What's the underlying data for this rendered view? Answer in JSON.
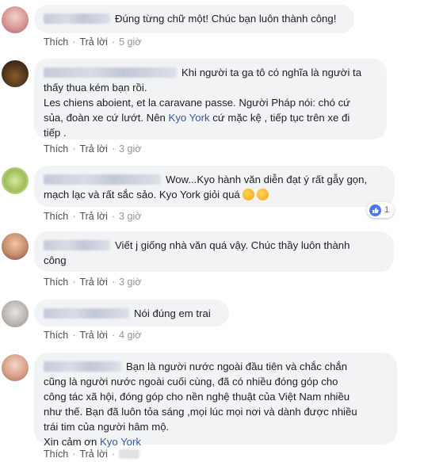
{
  "actions": {
    "like_label": "Thích",
    "reply_label": "Trả lời",
    "separator": "·"
  },
  "comments": [
    {
      "text": "Đúng từng chữ một! Chúc bạn luôn thành công!",
      "time": "5 giờ"
    },
    {
      "lines": [
        "Khi người ta ga tô có nghĩa là người ta",
        "thấy thua kém bạn rồi.",
        "Les chiens aboient, et la caravane passe. Người Pháp nói: chó cứ",
        "sủa, đoàn xe cứ lướt. Nên ",
        " cứ mặc kệ , tiếp tục trên xe đi",
        "tiếp ."
      ],
      "mention": "Kyo York",
      "time": "3 giờ"
    },
    {
      "lines": [
        "Wow...Kyo hành văn diễn đạt ý rất gẫy gọn,",
        "mạch lạc và rất sắc sảo. Kyo York giỏi quá"
      ],
      "time": "3 giờ",
      "reaction_count": "1"
    },
    {
      "lines": [
        "Viết j giống nhà văn quá vậy. Chúc thầy luôn thành",
        "công"
      ],
      "time": "3 giờ"
    },
    {
      "text": "Nói đúng em trai",
      "time": "4 giờ"
    },
    {
      "lines": [
        "Bạn là người nước ngoài đầu tiên và chắc chắn",
        "cũng là người nước ngoài cuối cùng, đã có nhiều đóng góp cho",
        "công tác xã hội, đóng góp cho nền nghệ thuật của Việt Nam nhiều",
        "như thế. Bạn đã luôn tỏa sáng ,mọi lúc mọi nơi và dành được nhiều",
        "trái tim của người hâm mộ.",
        "Xin cảm ơn "
      ],
      "mention": "Kyo York"
    }
  ]
}
